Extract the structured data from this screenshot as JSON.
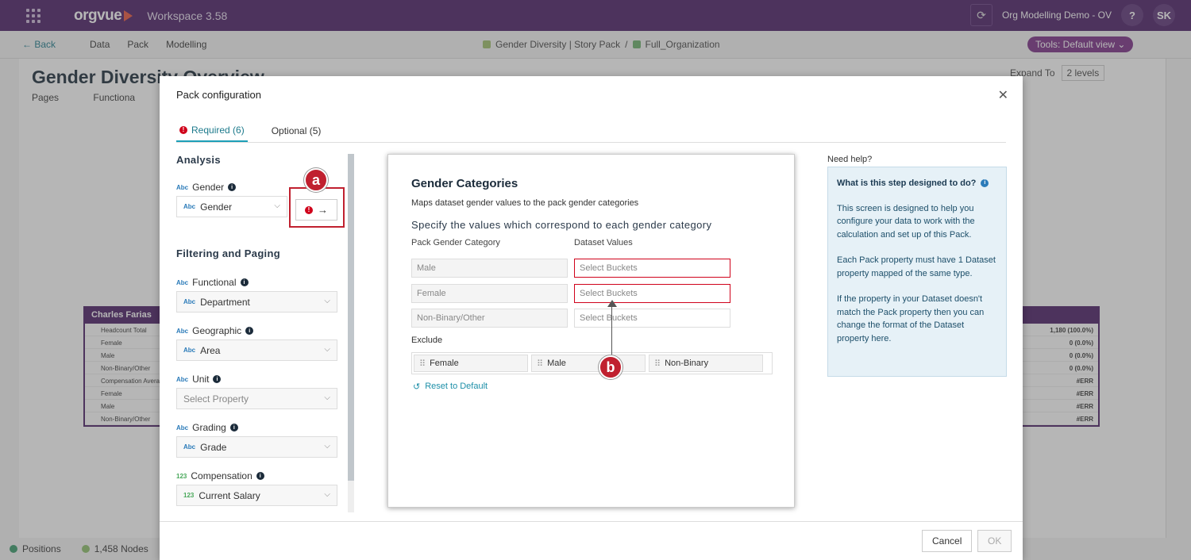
{
  "topbar": {
    "logo": "orgvue",
    "workspace": "Workspace  3.58",
    "org_name": "Org Modelling Demo - OV",
    "help": "?",
    "avatar": "SK"
  },
  "nav": {
    "back": "← Back",
    "items": [
      "Data",
      "Pack",
      "Modelling"
    ],
    "breadcrumb_story": "Gender Diversity | Story Pack",
    "breadcrumb_sep": "/",
    "breadcrumb_dataset": "Full_Organization",
    "tools": "Tools: Default view ⌄"
  },
  "page": {
    "title": "Gender Diversity Overview",
    "pages_label": "Pages",
    "pages_item": "Functiona",
    "expand_to": "Expand To",
    "expand_value": "2 levels",
    "tile_title": "Charles Farias",
    "tile_rows": [
      {
        "label": "Headcount Total",
        "value": "1,180 (100.0%)"
      },
      {
        "label": "Female",
        "value": "0 (0.0%)"
      },
      {
        "label": "Male",
        "value": "0 (0.0%)"
      },
      {
        "label": "Non-Binary/Other",
        "value": "0 (0.0%)"
      },
      {
        "label": "Compensation Avera",
        "value": "#ERR"
      },
      {
        "label": "Female",
        "value": "#ERR"
      },
      {
        "label": "Male",
        "value": "#ERR"
      },
      {
        "label": "Non-Binary/Other",
        "value": "#ERR"
      }
    ]
  },
  "status": {
    "positions": "Positions",
    "nodes": "1,458 Nodes"
  },
  "modal": {
    "title": "Pack configuration",
    "close": "✕",
    "tabs": [
      {
        "label": "Required (6)"
      },
      {
        "label": "Optional (5)"
      }
    ],
    "analysis_title": "Analysis",
    "filtering_title": "Filtering and Paging",
    "fields": {
      "gender": {
        "type": "Abc",
        "label": "Gender",
        "value": "Gender"
      },
      "functional": {
        "type": "Abc",
        "label": "Functional",
        "value": "Department"
      },
      "geographic": {
        "type": "Abc",
        "label": "Geographic",
        "value": "Area"
      },
      "unit": {
        "type": "Abc",
        "label": "Unit",
        "placeholder": "Select Property"
      },
      "grading": {
        "type": "Abc",
        "label": "Grading",
        "value": "Grade"
      },
      "compensation": {
        "type": "123",
        "label": "Compensation",
        "value": "Current Salary"
      }
    },
    "card": {
      "title": "Gender Categories",
      "subtitle": "Maps dataset gender values to the pack gender categories",
      "specify": "Specify the values which correspond to each gender category",
      "col_pack": "Pack Gender Category",
      "col_dataset": "Dataset Values",
      "categories": [
        "Male",
        "Female",
        "Non-Binary/Other"
      ],
      "bucket_placeholder": "Select Buckets",
      "exclude_label": "Exclude",
      "exclude_chips": [
        "Female",
        "Male",
        "Non-Binary"
      ],
      "reset": "Reset to Default"
    },
    "help": {
      "title": "Need help?",
      "question": "What is this step designed to do?",
      "p1": "This screen is designed to help you configure your data to work with the calculation and set up of this Pack.",
      "p2": "Each Pack property must have 1 Dataset property mapped of the same type.",
      "p3": "If the property in your Dataset doesn't match the Pack property then you can change the format of the Dataset property here."
    },
    "cancel": "Cancel",
    "ok": "OK"
  },
  "callouts": {
    "a": "a",
    "b": "b"
  },
  "colors": {
    "topbar": "#4a1e66",
    "accent": "#1d7a8c",
    "error": "#d0021b",
    "callout": "#c0202f"
  }
}
